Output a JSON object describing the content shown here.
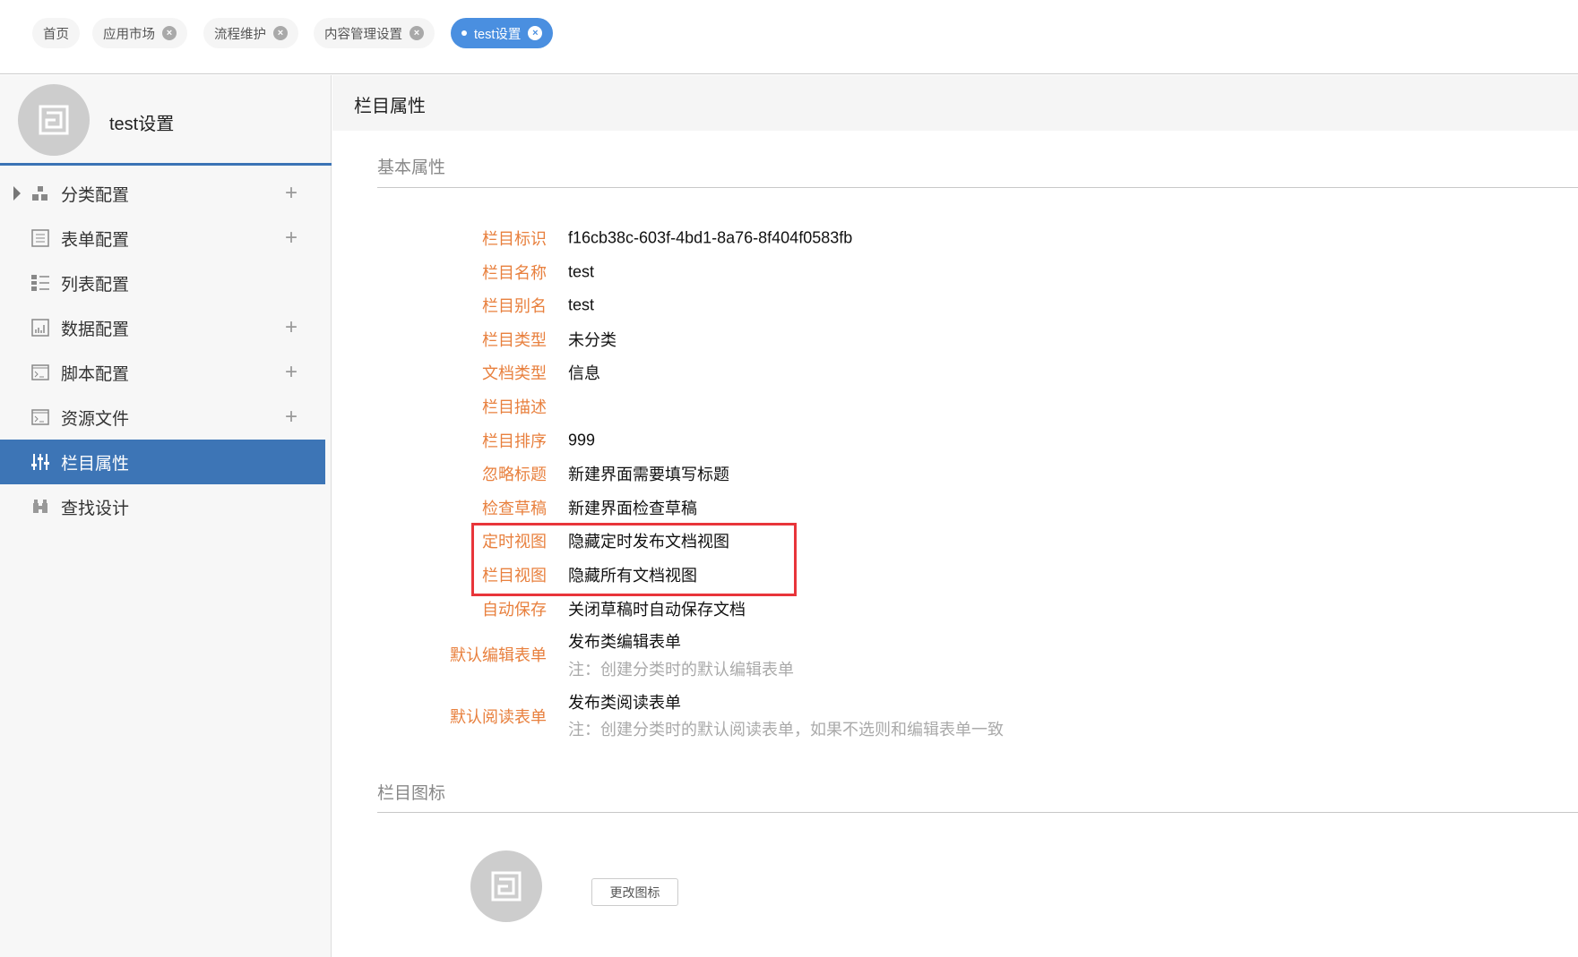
{
  "tabs": [
    {
      "label": "首页",
      "closable": false
    },
    {
      "label": "应用市场",
      "closable": true
    },
    {
      "label": "流程维护",
      "closable": true
    },
    {
      "label": "内容管理设置",
      "closable": true
    },
    {
      "label": "test设置",
      "closable": true,
      "active": true
    }
  ],
  "sidebar": {
    "title": "test设置",
    "items": [
      {
        "label": "分类配置",
        "icon": "blocks-icon",
        "plus": "+"
      },
      {
        "label": "表单配置",
        "icon": "form-icon",
        "plus": "+"
      },
      {
        "label": "列表配置",
        "icon": "list-icon"
      },
      {
        "label": "数据配置",
        "icon": "bar-chart-icon",
        "plus": "+"
      },
      {
        "label": "脚本配置",
        "icon": "terminal-icon",
        "plus": "+"
      },
      {
        "label": "资源文件",
        "icon": "terminal-icon",
        "plus": "+"
      },
      {
        "label": "栏目属性",
        "icon": "sliders-icon",
        "active": true
      },
      {
        "label": "查找设计",
        "icon": "binoculars-icon"
      }
    ]
  },
  "content": {
    "header": "栏目属性",
    "basic_title": "基本属性",
    "rows": [
      {
        "label": "栏目标识",
        "value": "f16cb38c-603f-4bd1-8a76-8f404f0583fb"
      },
      {
        "label": "栏目名称",
        "value": "test"
      },
      {
        "label": "栏目别名",
        "value": "test"
      },
      {
        "label": "栏目类型",
        "value": "未分类"
      },
      {
        "label": "文档类型",
        "value": "信息"
      },
      {
        "label": "栏目描述",
        "value": ""
      },
      {
        "label": "栏目排序",
        "value": "999"
      },
      {
        "label": "忽略标题",
        "value": "新建界面需要填写标题"
      },
      {
        "label": "检查草稿",
        "value": "新建界面检查草稿"
      },
      {
        "label": "定时视图",
        "value": "隐藏定时发布文档视图"
      },
      {
        "label": "栏目视图",
        "value": "隐藏所有文档视图"
      },
      {
        "label": "自动保存",
        "value": "关闭草稿时自动保存文档"
      }
    ],
    "edit_form": {
      "label": "默认编辑表单",
      "value": "发布类编辑表单",
      "note": "注：创建分类时的默认编辑表单"
    },
    "read_form": {
      "label": "默认阅读表单",
      "value": "发布类阅读表单",
      "note": "注：创建分类时的默认阅读表单，如果不选则和编辑表单一致"
    },
    "icon_title": "栏目图标",
    "change_icon_button": "更改图标"
  },
  "colors": {
    "accent": "#3d75b6",
    "tab_active": "#4a8fe0",
    "label": "#e8803e",
    "highlight": "#e8353a"
  }
}
